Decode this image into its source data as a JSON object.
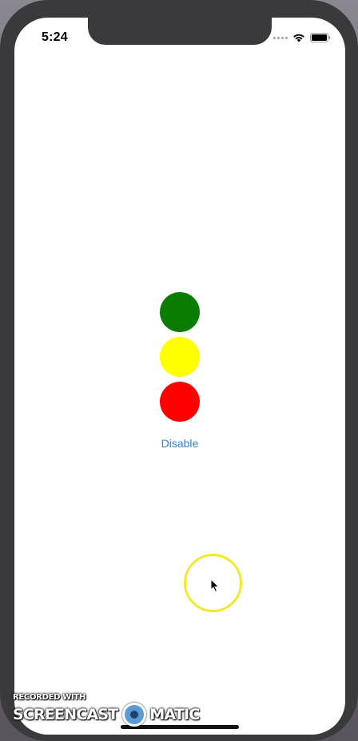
{
  "status_bar": {
    "time": "5:24",
    "wifi_icon": "wifi-icon",
    "battery_icon": "battery-icon"
  },
  "traffic_light": {
    "lights": [
      {
        "name": "green",
        "color": "#0a7d00"
      },
      {
        "name": "yellow",
        "color": "#ffff00"
      },
      {
        "name": "red",
        "color": "#ff0000"
      }
    ]
  },
  "disable_button": {
    "label": "Disable",
    "color": "#2f83e6"
  },
  "watermark": {
    "line1": "RECORDED WITH",
    "brand_left": "SCREENCAST",
    "brand_right": "MATIC"
  },
  "colors": {
    "frame": "#3a3a3c",
    "cursor_ring": "#f2e92a"
  }
}
